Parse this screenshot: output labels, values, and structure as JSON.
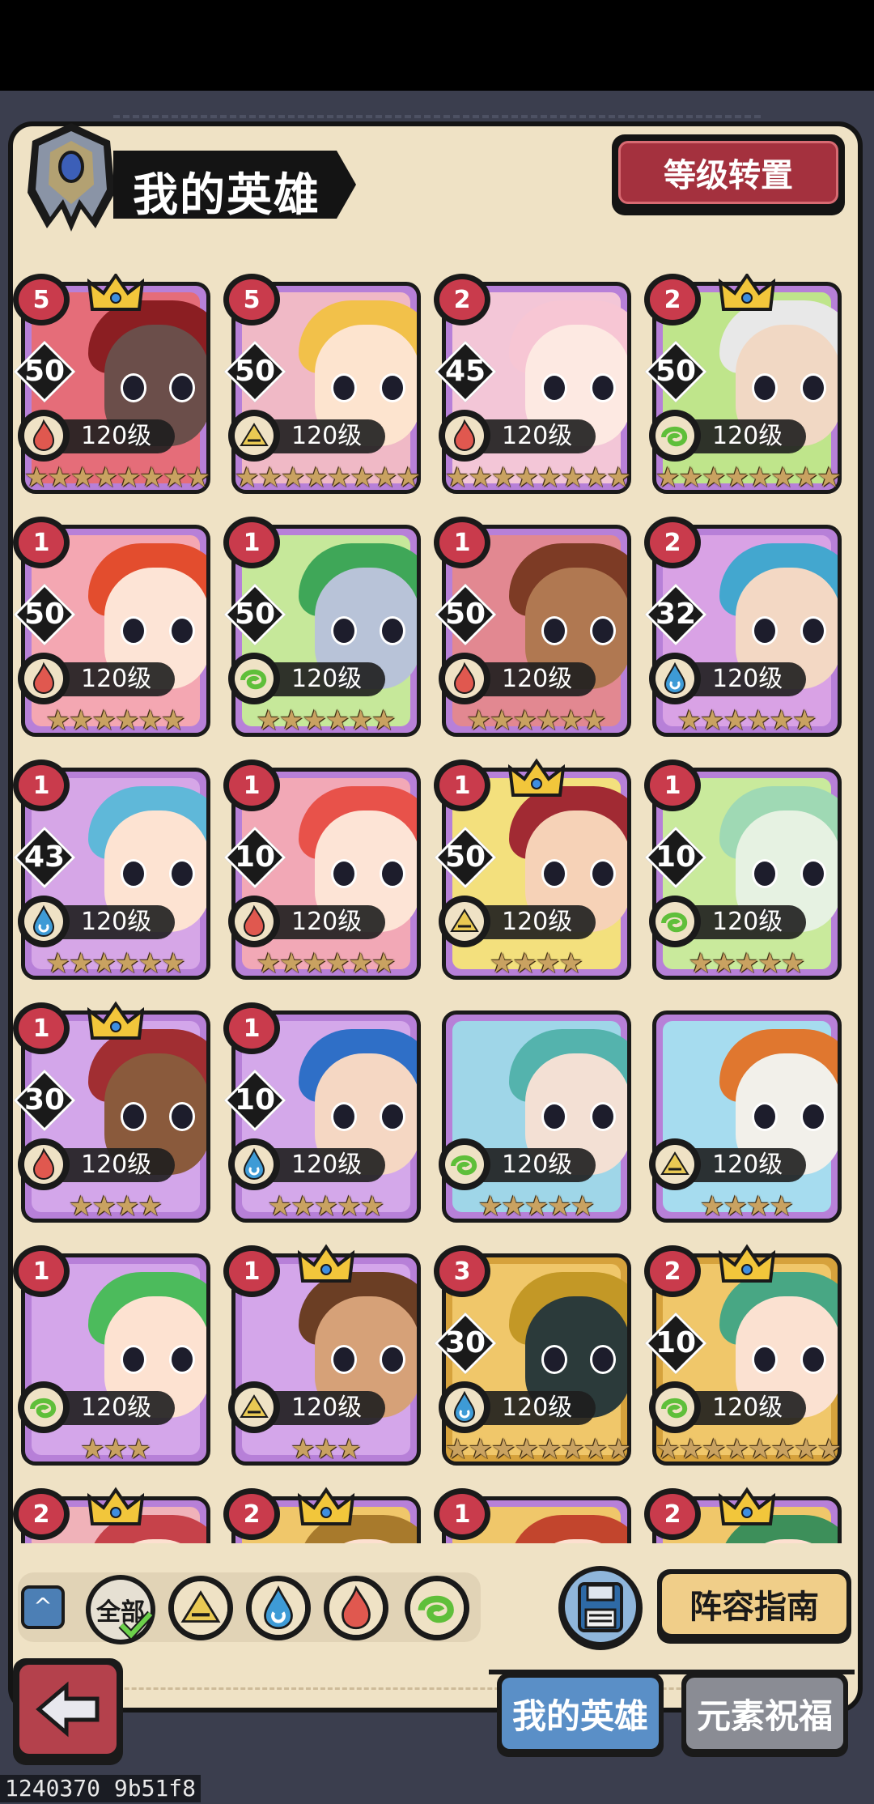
{
  "header": {
    "title": "我的英雄",
    "level_transfer_button": "等级转置"
  },
  "heroes": [
    {
      "rank": "5",
      "crown": true,
      "level": "50",
      "element": "fire",
      "level_label": "120级",
      "stars": "★★★★★★★★",
      "bg": "#e56d79",
      "hair": "#8b1e22",
      "skin": "#6b4e4a"
    },
    {
      "rank": "5",
      "crown": false,
      "level": "50",
      "element": "earth",
      "level_label": "120级",
      "stars": "★★★★★★★★",
      "bg": "#f0b9c6",
      "hair": "#f2c14a",
      "skin": "#fde4cf"
    },
    {
      "rank": "2",
      "crown": false,
      "level": "45",
      "element": "fire",
      "level_label": "120级",
      "stars": "★★★★★★★★",
      "bg": "#f3c6d7",
      "hair": "#f7c6d4",
      "skin": "#fde9e2"
    },
    {
      "rank": "2",
      "crown": true,
      "level": "50",
      "element": "wind",
      "level_label": "120级",
      "stars": "★★★★★★★★",
      "bg": "#bfe58b",
      "hair": "#e8e8e8",
      "skin": "#f1d8c4"
    },
    {
      "rank": "1",
      "crown": false,
      "level": "50",
      "element": "fire",
      "level_label": "120级",
      "stars": "★★★★★★",
      "bg": "#f4a7b2",
      "hair": "#e34d2e",
      "skin": "#fde4d6"
    },
    {
      "rank": "1",
      "crown": false,
      "level": "50",
      "element": "wind",
      "level_label": "120级",
      "stars": "★★★★★★",
      "bg": "#c6e89a",
      "hair": "#3fa758",
      "skin": "#b8c3d8"
    },
    {
      "rank": "1",
      "crown": false,
      "level": "50",
      "element": "fire",
      "level_label": "120级",
      "stars": "★★★★★★",
      "bg": "#e28891",
      "hair": "#7d3b25",
      "skin": "#b07851"
    },
    {
      "rank": "2",
      "crown": false,
      "level": "32",
      "element": "water",
      "level_label": "120级",
      "stars": "★★★★★★",
      "bg": "#d9a2e5",
      "hair": "#43a7cf",
      "skin": "#f3d8c4"
    },
    {
      "rank": "1",
      "crown": false,
      "level": "43",
      "element": "water",
      "level_label": "120级",
      "stars": "★★★★★★",
      "bg": "#d6a6e7",
      "hair": "#5fb8d9",
      "skin": "#fde3d2"
    },
    {
      "rank": "1",
      "crown": false,
      "level": "10",
      "element": "fire",
      "level_label": "120级",
      "stars": "★★★★★★",
      "bg": "#f2a8b6",
      "hair": "#e8524a",
      "skin": "#fde4d6"
    },
    {
      "rank": "1",
      "crown": true,
      "level": "50",
      "element": "earth",
      "level_label": "120级",
      "stars": "★★★★",
      "bg": "#f3e07d",
      "hair": "#a12a33",
      "skin": "#f6d2b7"
    },
    {
      "rank": "1",
      "crown": false,
      "level": "10",
      "element": "wind",
      "level_label": "120级",
      "stars": "★★★★★",
      "bg": "#c9ea9c",
      "hair": "#9fd9b4",
      "skin": "#e6f2e2"
    },
    {
      "rank": "1",
      "crown": true,
      "level": "30",
      "element": "fire",
      "level_label": "120级",
      "stars": "★★★★",
      "bg": "#d3a6ea",
      "hair": "#a12e32",
      "skin": "#8a5a3c"
    },
    {
      "rank": "1",
      "crown": false,
      "level": "10",
      "element": "water",
      "level_label": "120级",
      "stars": "★★★★★",
      "bg": "#d4a8ea",
      "hair": "#2f6fc7",
      "skin": "#f5d7c3"
    },
    {
      "rank": "",
      "crown": false,
      "level": "",
      "element": "wind",
      "level_label": "120级",
      "stars": "★★★★★",
      "bg": "#9fd6e8",
      "hair": "#54b3ad",
      "skin": "#f3e0d4"
    },
    {
      "rank": "",
      "crown": false,
      "level": "",
      "element": "earth",
      "level_label": "120级",
      "stars": "★★★★",
      "bg": "#a6dcef",
      "hair": "#e0772f",
      "skin": "#f2f0ea"
    },
    {
      "rank": "1",
      "crown": false,
      "level": "",
      "element": "wind",
      "level_label": "120级",
      "stars": "★★★",
      "bg": "#d4a6ea",
      "hair": "#4cbb5c",
      "skin": "#fde2d1"
    },
    {
      "rank": "1",
      "crown": true,
      "level": "",
      "element": "earth",
      "level_label": "120级",
      "stars": "★★★",
      "bg": "#d4a6ea",
      "hair": "#6b3e24",
      "skin": "#d6a178"
    },
    {
      "rank": "3",
      "crown": false,
      "level": "30",
      "element": "water",
      "level_label": "120级",
      "stars": "★★★★★★★★",
      "bg": "#f0c76a",
      "hair": "#c39826",
      "skin": "#2b3a3a"
    },
    {
      "rank": "2",
      "crown": true,
      "level": "10",
      "element": "wind",
      "level_label": "120级",
      "stars": "★★★★★★★★",
      "bg": "#f0c76a",
      "hair": "#48a784",
      "skin": "#fbe1d1"
    },
    {
      "rank": "2",
      "crown": true,
      "level": "",
      "element": "fire",
      "level_label": "",
      "stars": "",
      "bg": "#f0b2b9",
      "hair": "#c6424a",
      "skin": "#fde0d0"
    },
    {
      "rank": "2",
      "crown": true,
      "level": "",
      "element": "earth",
      "level_label": "",
      "stars": "",
      "bg": "#f0c76a",
      "hair": "#a87a2c",
      "skin": "#fde0d0"
    },
    {
      "rank": "1",
      "crown": false,
      "level": "",
      "element": "fire",
      "level_label": "",
      "stars": "",
      "bg": "#f0c76a",
      "hair": "#c2452d",
      "skin": "#fde0d0"
    },
    {
      "rank": "2",
      "crown": true,
      "level": "",
      "element": "wind",
      "level_label": "",
      "stars": "",
      "bg": "#f0c76a",
      "hair": "#3d8f5a",
      "skin": "#fde0d0"
    }
  ],
  "filters": {
    "all_label": "全部",
    "elements": [
      "earth",
      "water",
      "fire",
      "wind"
    ]
  },
  "guide_button": "阵容指南",
  "tabs": {
    "my_heroes": "我的英雄",
    "element_blessing": "元素祝福"
  },
  "footer_id": "1240370 9b51f8",
  "colors": {
    "fire": "#e0584f",
    "water": "#3e9bd6",
    "earth": "#e9c953",
    "wind": "#5fbf3a"
  }
}
